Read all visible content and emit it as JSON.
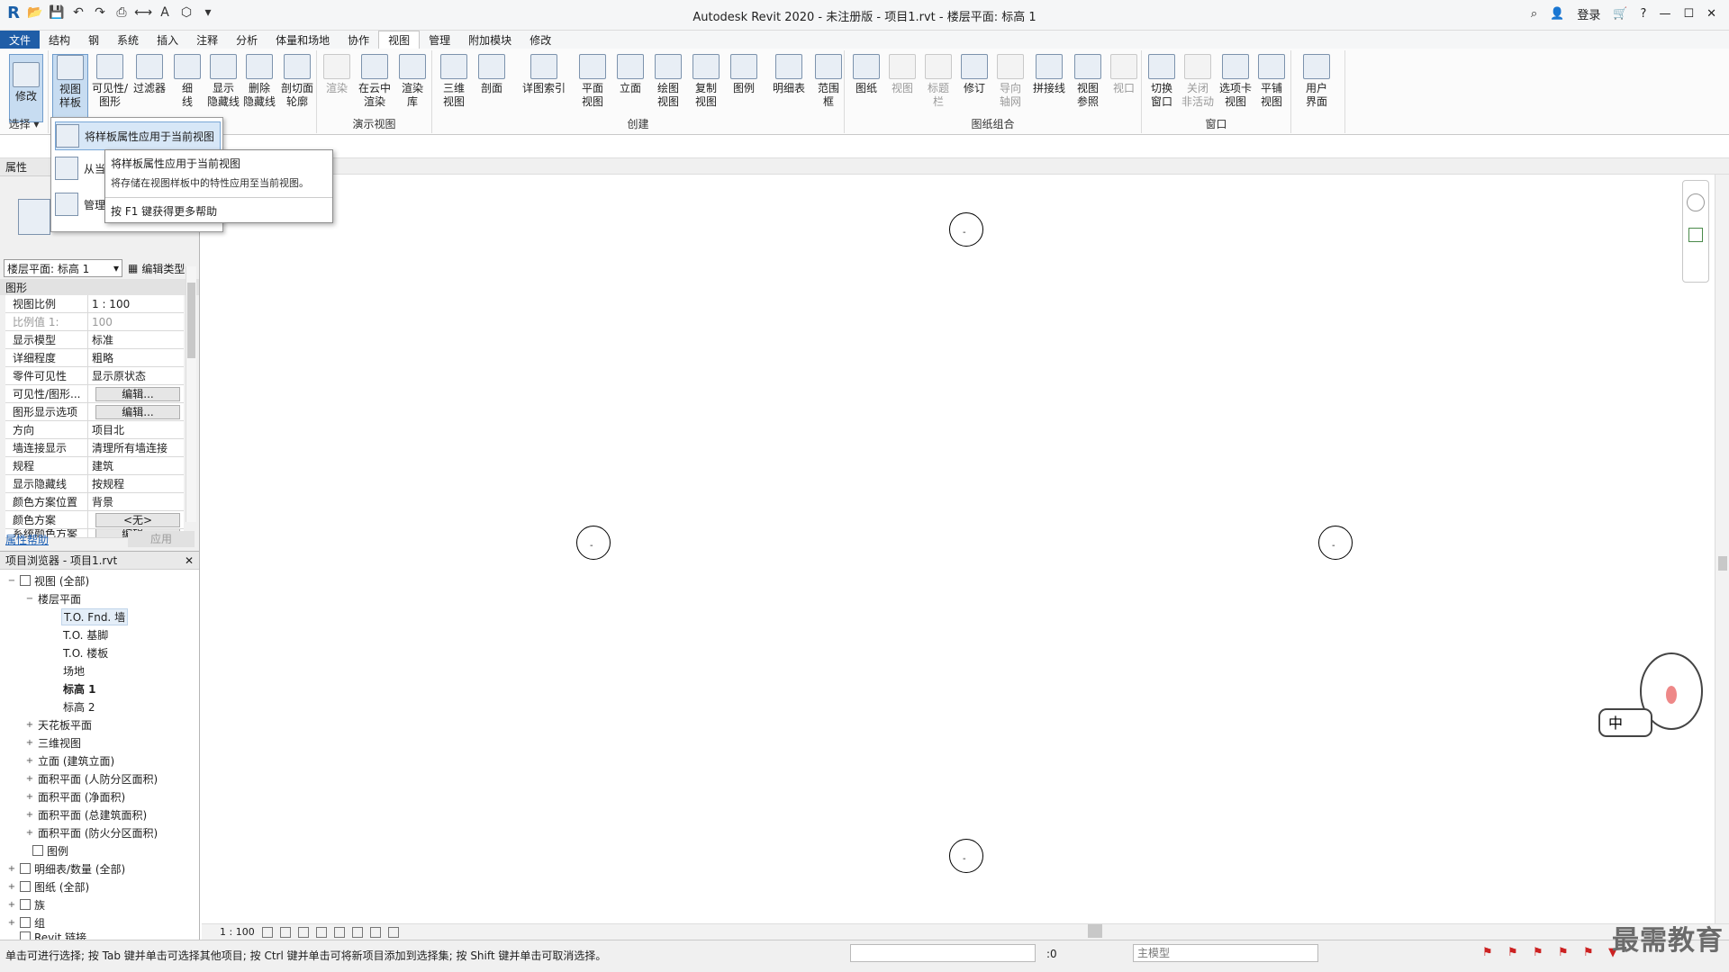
{
  "titlebar": {
    "title": "Autodesk Revit 2020 - 未注册版 - 项目1.rvt - 楼层平面: 标高 1",
    "login": "登录",
    "logo": "R",
    "win_buttons": [
      "—",
      "☐",
      "✕"
    ]
  },
  "menu": [
    "文件",
    "结构",
    "钢",
    "系统",
    "插入",
    "注释",
    "分析",
    "体量和场地",
    "协作",
    "视图",
    "管理",
    "附加模块",
    "修改"
  ],
  "ribbon": {
    "select_group": "选择 ▾",
    "modify": "修改",
    "view_template": "视图\n样板",
    "visibility": "可见性/\n图形",
    "filters": "过滤器",
    "thin_lines": "细\n线",
    "show_hidden": "显示\n隐藏线",
    "remove_hidden": "删除\n隐藏线",
    "cut_profile": "剖切面\n轮廓",
    "render": "渲染",
    "render_cloud": "在云中\n渲染",
    "render_gallery": "渲染\n库",
    "presentation_label": "演示视图",
    "three_d": "三维\n视图",
    "section": "剖面",
    "callout": "详图索引",
    "plan_views": "平面\n视图",
    "elevation": "立面",
    "drafting": "绘图\n视图",
    "duplicate": "复制\n视图",
    "legends": "图例",
    "schedules": "明细表",
    "scope_box": "范围\n框",
    "create_label": "创建",
    "sheet": "图纸",
    "view_btn": "视图",
    "title_block": "标题\n栏",
    "revisions": "修订",
    "guide_grid": "导向\n轴网",
    "matchline": "拼接线",
    "view_ref": "视图\n参照",
    "viewports": "视口",
    "sheet_label": "图纸组合",
    "switch_windows": "切换\n窗口",
    "close_inactive": "关闭\n非活动",
    "tab_views": "选项卡\n视图",
    "tile_views": "平铺\n视图",
    "window_label": "窗口",
    "user_interface": "用户\n界面"
  },
  "dropdown": {
    "item1": "将样板属性应用于当前视图",
    "item2": "从当",
    "item3": "管理"
  },
  "tooltip": {
    "title": "将样板属性应用于当前视图",
    "desc": "将存储在视图样板中的特性应用至当前视图。",
    "help": "按 F1 键获得更多帮助"
  },
  "properties": {
    "header": "属性",
    "type_selector": "楼层平面: 标高 1",
    "edit_type": "编辑类型",
    "category": "图形",
    "rows": [
      {
        "k": "视图比例",
        "v": "1 : 100"
      },
      {
        "k": "比例值 1:",
        "v": "100"
      },
      {
        "k": "显示模型",
        "v": "标准"
      },
      {
        "k": "详细程度",
        "v": "粗略"
      },
      {
        "k": "零件可见性",
        "v": "显示原状态"
      },
      {
        "k": "可见性/图形...",
        "v": "编辑..."
      },
      {
        "k": "图形显示选项",
        "v": "编辑..."
      },
      {
        "k": "方向",
        "v": "项目北"
      },
      {
        "k": "墙连接显示",
        "v": "清理所有墙连接"
      },
      {
        "k": "规程",
        "v": "建筑"
      },
      {
        "k": "显示隐藏线",
        "v": "按规程"
      },
      {
        "k": "颜色方案位置",
        "v": "背景"
      },
      {
        "k": "颜色方案",
        "v": "<无>"
      },
      {
        "k": "系统颜色方案",
        "v": "编辑..."
      }
    ],
    "help": "属性帮助",
    "apply": "应用"
  },
  "browser": {
    "header": "项目浏览器 - 项目1.rvt",
    "nodes": [
      {
        "label": "视图 (全部)",
        "exp": "−"
      },
      {
        "label": "楼层平面",
        "exp": "−"
      },
      {
        "label": "T.O. Fnd. 墙",
        "exp": ""
      },
      {
        "label": "T.O. 基脚",
        "exp": ""
      },
      {
        "label": "T.O. 楼板",
        "exp": ""
      },
      {
        "label": "场地",
        "exp": ""
      },
      {
        "label": "标高 1",
        "exp": ""
      },
      {
        "label": "标高 2",
        "exp": ""
      },
      {
        "label": "天花板平面",
        "exp": "+"
      },
      {
        "label": "三维视图",
        "exp": "+"
      },
      {
        "label": "立面 (建筑立面)",
        "exp": "+"
      },
      {
        "label": "面积平面 (人防分区面积)",
        "exp": "+"
      },
      {
        "label": "面积平面 (净面积)",
        "exp": "+"
      },
      {
        "label": "面积平面 (总建筑面积)",
        "exp": "+"
      },
      {
        "label": "面积平面 (防火分区面积)",
        "exp": "+"
      },
      {
        "label": "图例",
        "exp": ""
      },
      {
        "label": "明细表/数量 (全部)",
        "exp": "+"
      },
      {
        "label": "图纸 (全部)",
        "exp": "+"
      },
      {
        "label": "族",
        "exp": "+"
      },
      {
        "label": "组",
        "exp": "+"
      },
      {
        "label": "Revit 链接",
        "exp": ""
      }
    ]
  },
  "view_bar": {
    "scale": "1 : 100"
  },
  "marker_text": "-",
  "mascot_text": "中",
  "status": {
    "text": "单击可进行选择; 按 Tab 键并单击可选择其他项目; 按 Ctrl 键并单击可将新项目添加到选择集; 按 Shift 键并单击可取消选择。",
    "zero": ":0",
    "model": "主模型"
  },
  "watermark": "最需教育",
  "colors": {
    "file_tab": "#1f5da7",
    "selected_tool": "#c7dcf1"
  }
}
